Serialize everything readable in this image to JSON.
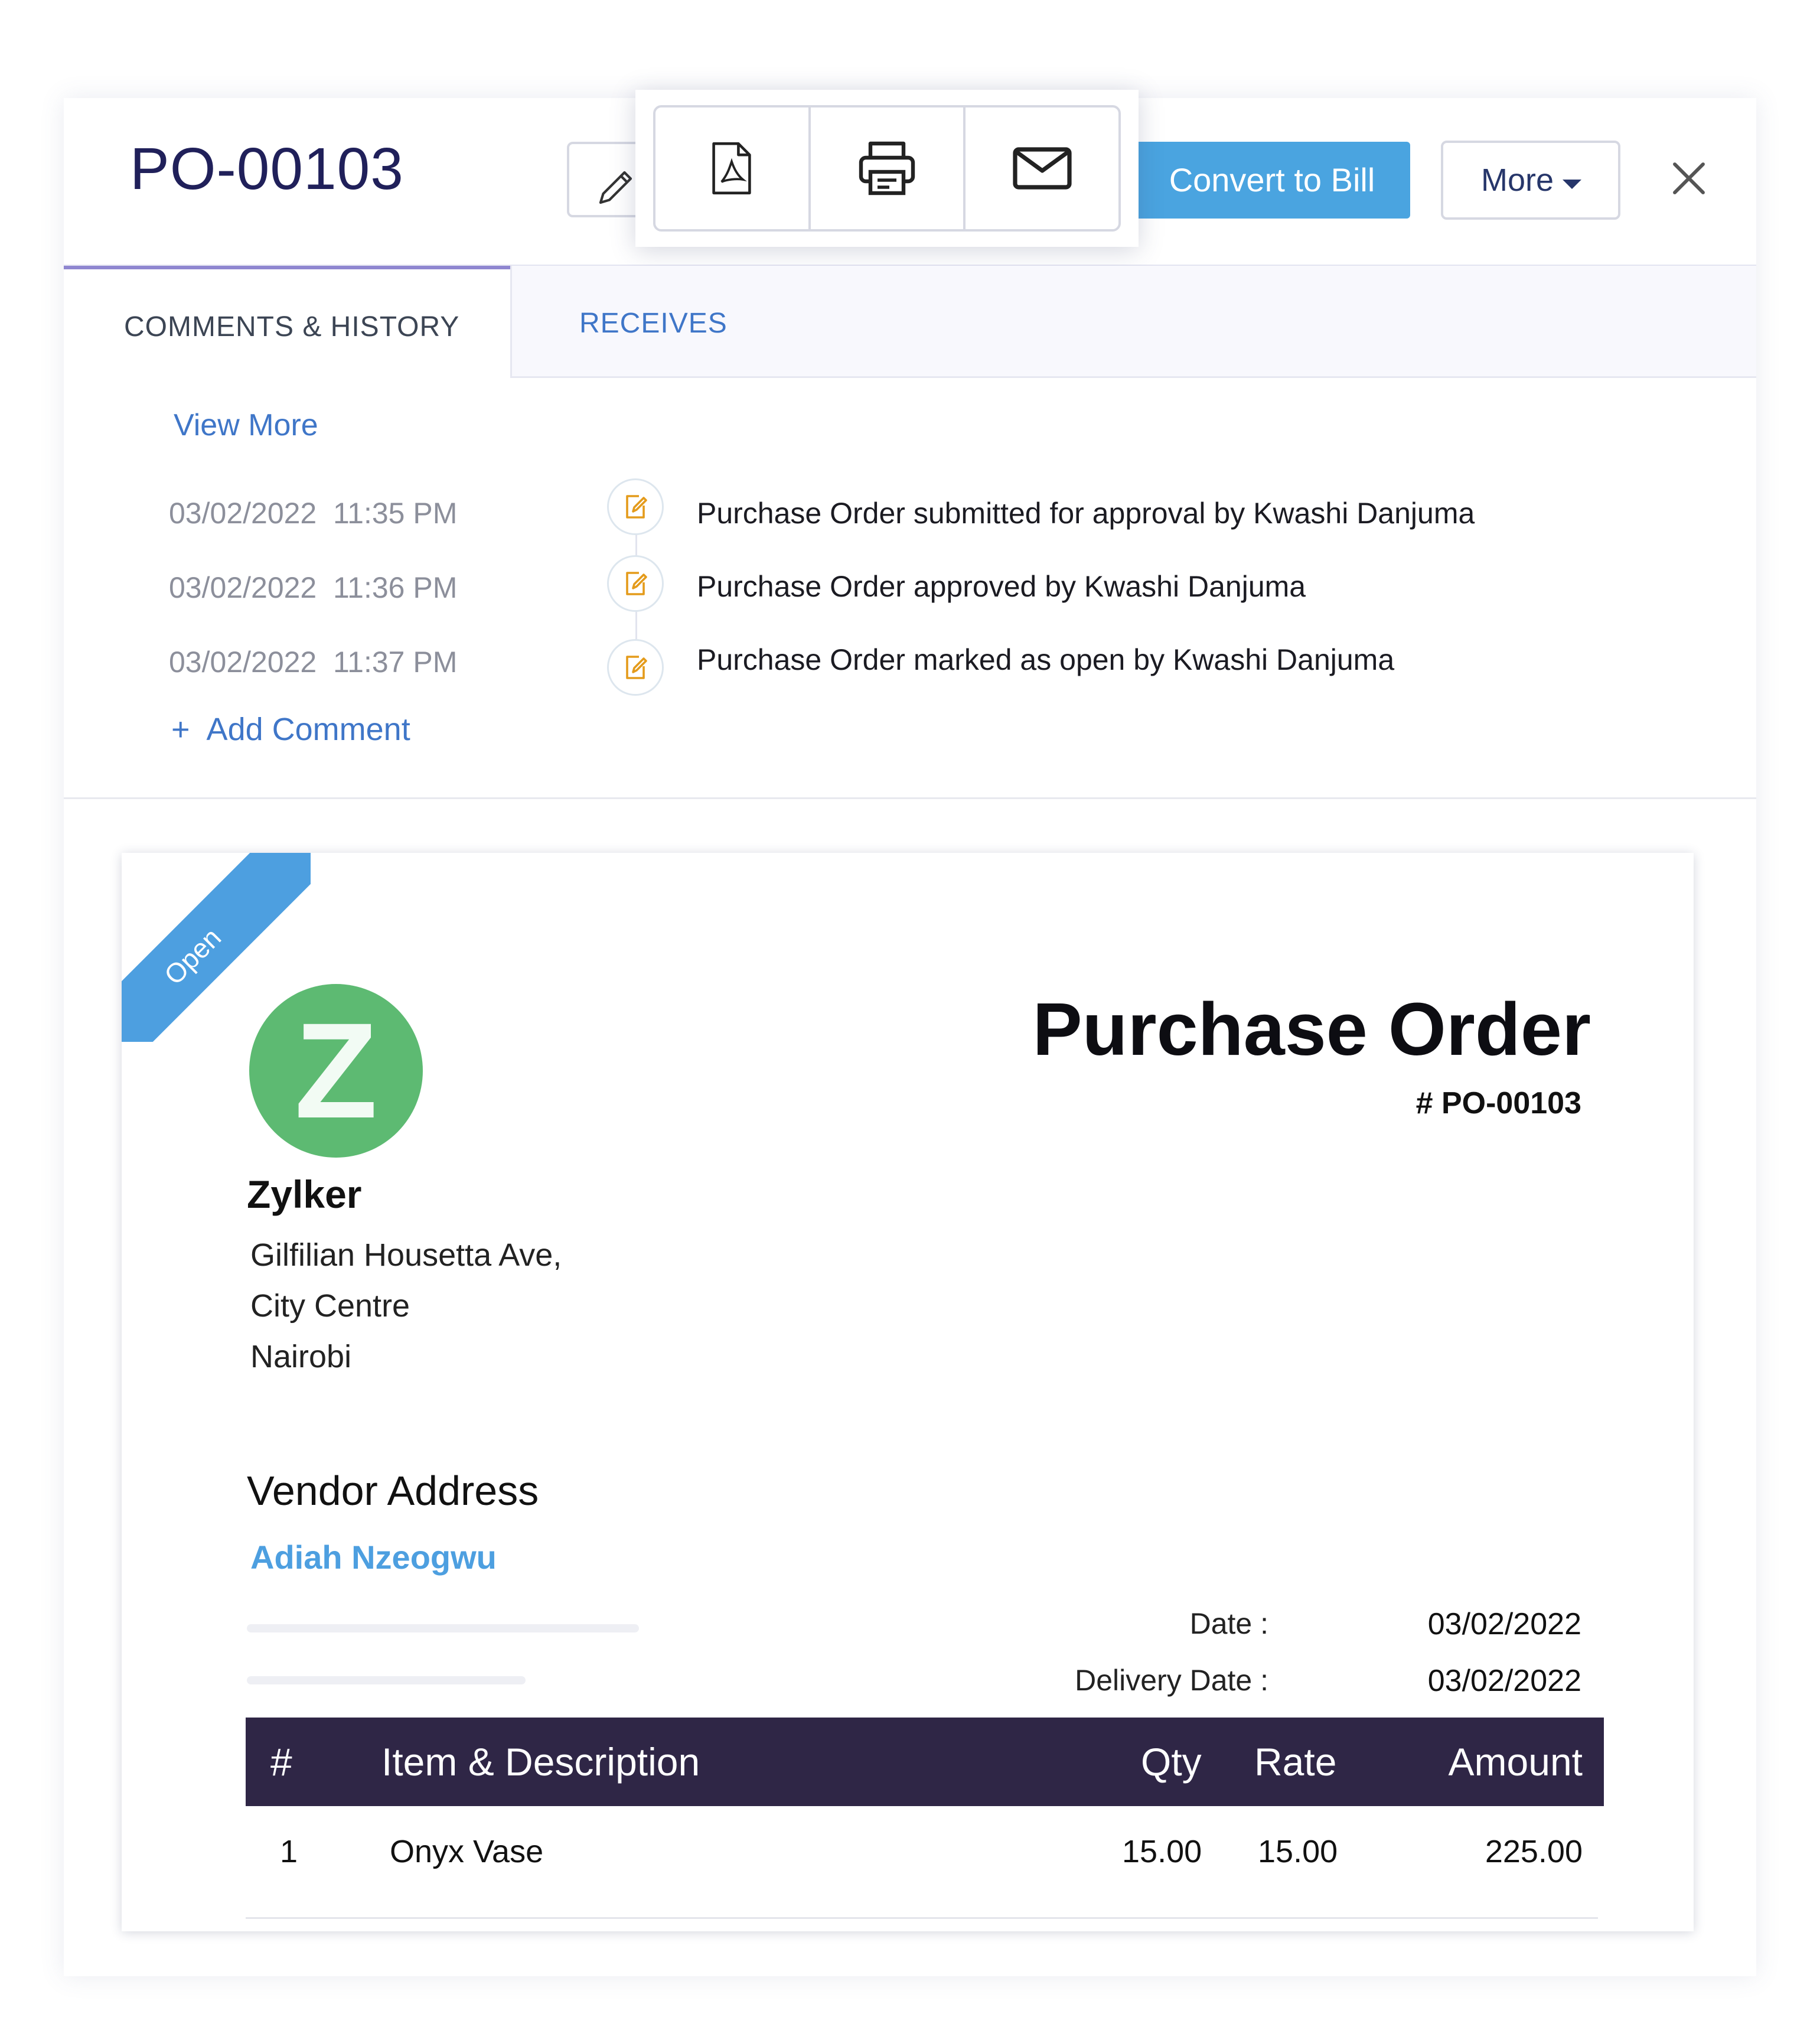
{
  "header": {
    "title": "PO-00103",
    "convert_label": "Convert to Bill",
    "more_label": "More"
  },
  "tabs": [
    {
      "label": "COMMENTS & HISTORY",
      "active": true
    },
    {
      "label": "RECEIVES",
      "active": false
    }
  ],
  "history": {
    "view_more": "View More",
    "add_comment": "Add Comment",
    "entries": [
      {
        "date": "03/02/2022",
        "time": "11:35 PM",
        "text": "Purchase Order submitted for approval by Kwashi Danjuma"
      },
      {
        "date": "03/02/2022",
        "time": "11:36 PM",
        "text": "Purchase Order approved by Kwashi Danjuma"
      },
      {
        "date": "03/02/2022",
        "time": "11:37 PM",
        "text": "Purchase Order marked as open by Kwashi Danjuma"
      }
    ]
  },
  "document": {
    "status": "Open",
    "logo_letter": "Z",
    "company": "Zylker",
    "address": [
      "Gilfilian Housetta Ave,",
      "City Centre",
      "Nairobi"
    ],
    "title": "Purchase Order",
    "number": "# PO-00103",
    "vendor_heading": "Vendor Address",
    "vendor_name": "Adiah Nzeogwu",
    "date_label": "Date :",
    "date_value": "03/02/2022",
    "delivery_label": "Delivery Date :",
    "delivery_value": "03/02/2022",
    "table": {
      "headers": [
        "#",
        "Item & Description",
        "Qty",
        "Rate",
        "Amount"
      ],
      "rows": [
        [
          "1",
          "Onyx Vase",
          "15.00",
          "15.00",
          "225.00"
        ]
      ]
    }
  },
  "colors": {
    "accent": "#4aa4e0",
    "title": "#20205a",
    "link": "#3f76c8",
    "table_header": "#2f2646",
    "logo": "#5dba72"
  },
  "icons": {
    "edit": "pencil-icon",
    "pdf": "pdf-icon",
    "print": "printer-icon",
    "email": "mail-icon",
    "close": "close-icon",
    "history": "edit-note-icon"
  }
}
